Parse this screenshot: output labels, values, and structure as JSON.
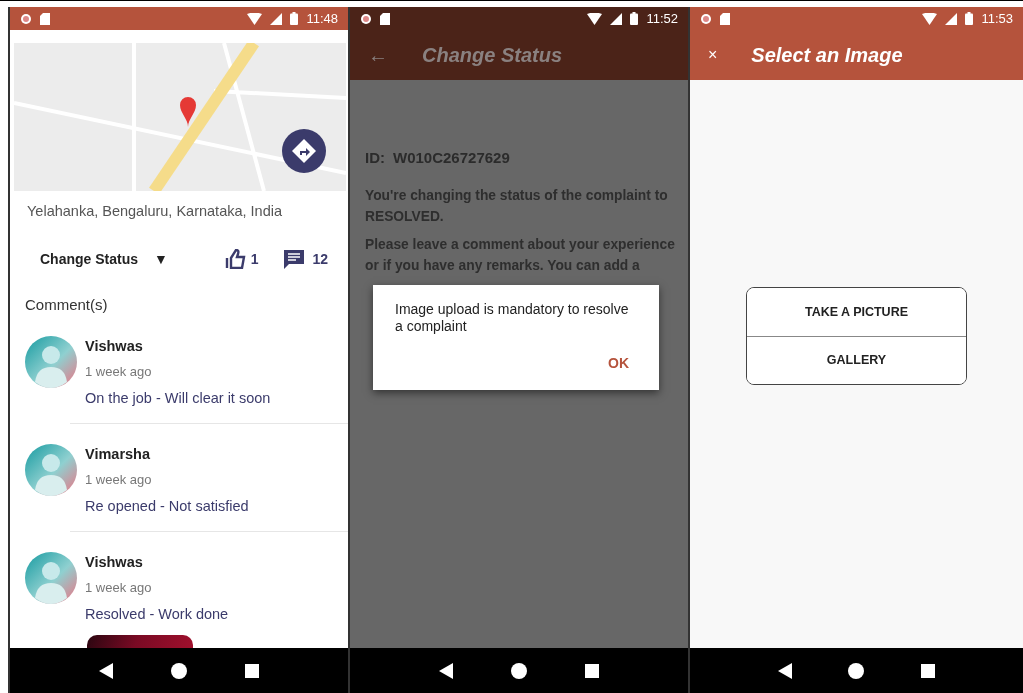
{
  "details_screen": {
    "status_bar": {
      "time": "11:48"
    },
    "address": "Yelahanka, Bengaluru, Karnataka, India",
    "change_status": {
      "label": "Change Status",
      "caret": "▼"
    },
    "likes": "1",
    "comment_count": "12",
    "comments_heading": "Comment(s)",
    "comments": [
      {
        "name": "Vishwas",
        "time": "1 week ago",
        "text": "On the job - Will clear it soon",
        "has_photo": false
      },
      {
        "name": "Vimarsha",
        "time": "1 week ago",
        "text": "Re opened - Not satisfied",
        "has_photo": false
      },
      {
        "name": "Vishwas",
        "time": "1 week ago",
        "text": "Resolved - Work done",
        "has_photo": true
      }
    ]
  },
  "change_status_screen": {
    "status_bar": {
      "time": "11:52"
    },
    "back": "←",
    "title": "Change Status",
    "id_label": "ID:",
    "id": "W010C26727629",
    "message": "You're changing the status of the complaint to RESOLVED.",
    "instructions": "Please leave a comment about your experience or if you have any remarks. You can add a",
    "dialog": {
      "message": "Image upload is mandatory to resolve a complaint",
      "button": "OK"
    }
  },
  "image_picker_screen": {
    "status_bar": {
      "time": "11:53"
    },
    "close": "×",
    "title": "Select an Image",
    "options": [
      "TAKE A PICTURE",
      "GALLERY"
    ]
  }
}
